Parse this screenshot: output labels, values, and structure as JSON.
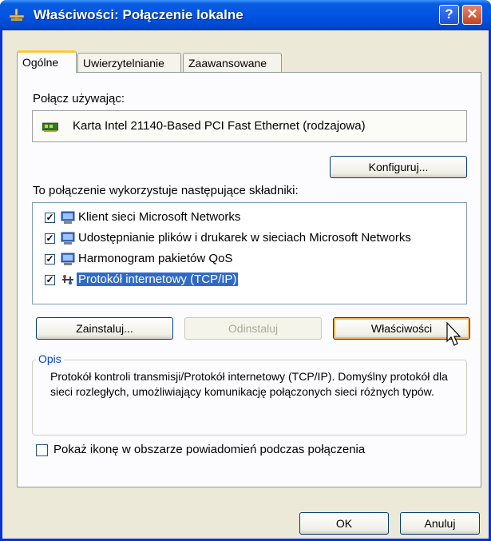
{
  "window": {
    "title": "Właściwości: Połączenie lokalne",
    "help_label": "?",
    "close_label": "✕"
  },
  "tabs": [
    {
      "label": "Ogólne",
      "active": true
    },
    {
      "label": "Uwierzytelnianie",
      "active": false
    },
    {
      "label": "Zaawansowane",
      "active": false
    }
  ],
  "general": {
    "connect_using_label": "Połącz używając:",
    "adapter_name": "Karta Intel 21140-Based PCI Fast Ethernet (rodzajowa)",
    "configure_button": "Konfiguruj...",
    "components_label": "To połączenie wykorzystuje następujące składniki:",
    "components": [
      {
        "label": "Klient sieci Microsoft Networks",
        "checked": true,
        "selected": false,
        "icon": "network-client-icon"
      },
      {
        "label": "Udostępnianie plików i drukarek w sieciach Microsoft Networks",
        "checked": true,
        "selected": false,
        "icon": "network-service-icon"
      },
      {
        "label": "Harmonogram pakietów QoS",
        "checked": true,
        "selected": false,
        "icon": "network-service-icon"
      },
      {
        "label": "Protokół internetowy (TCP/IP)",
        "checked": true,
        "selected": true,
        "icon": "protocol-icon"
      }
    ],
    "install_button": "Zainstaluj...",
    "uninstall_button": "Odinstaluj",
    "properties_button": "Właściwości",
    "description_legend": "Opis",
    "description_text": "Protokół kontroli transmisji/Protokół internetowy (TCP/IP). Domyślny protokół dla sieci rozległych, umożliwiający komunikację połączonych sieci różnych typów.",
    "show_icon_label": "Pokaż ikonę w obszarze powiadomień podczas połączenia",
    "show_icon_checked": false
  },
  "footer": {
    "ok_button": "OK",
    "cancel_button": "Anuluj"
  },
  "colors": {
    "titlebar": "#0054e3",
    "selection": "#316ac5",
    "dialog_bg": "#ece9d8"
  }
}
